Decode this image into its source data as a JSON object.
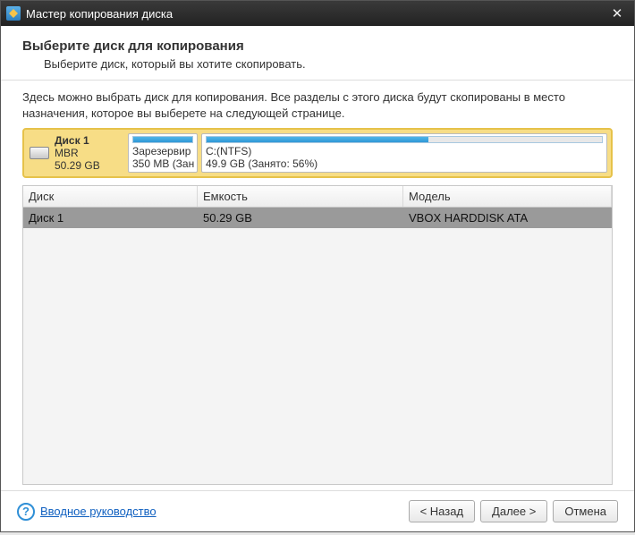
{
  "window": {
    "title": "Мастер копирования диска"
  },
  "header": {
    "title": "Выберите диск для копирования",
    "subtitle": "Выберите диск, который вы хотите скопировать."
  },
  "description": "Здесь можно выбрать диск для копирования. Все разделы с этого диска будут скопированы в место назначения, которое вы выберете на следующей странице.",
  "disk": {
    "name": "Диск 1",
    "type": "MBR",
    "size": "50.29 GB",
    "partitions": [
      {
        "label1": "Зарезервир",
        "label2": "350 MB (Зан",
        "fill_pct": 100
      },
      {
        "label1": "C:(NTFS)",
        "label2": "49.9 GB (Занято: 56%)",
        "fill_pct": 56
      }
    ]
  },
  "table": {
    "headers": {
      "disk": "Диск",
      "capacity": "Емкость",
      "model": "Модель"
    },
    "rows": [
      {
        "disk": "Диск 1",
        "capacity": "50.29 GB",
        "model": "VBOX HARDDISK ATA"
      }
    ]
  },
  "footer": {
    "help_link": "Вводное руководство",
    "back": "< Назад",
    "next": "Далее >",
    "cancel": "Отмена"
  }
}
